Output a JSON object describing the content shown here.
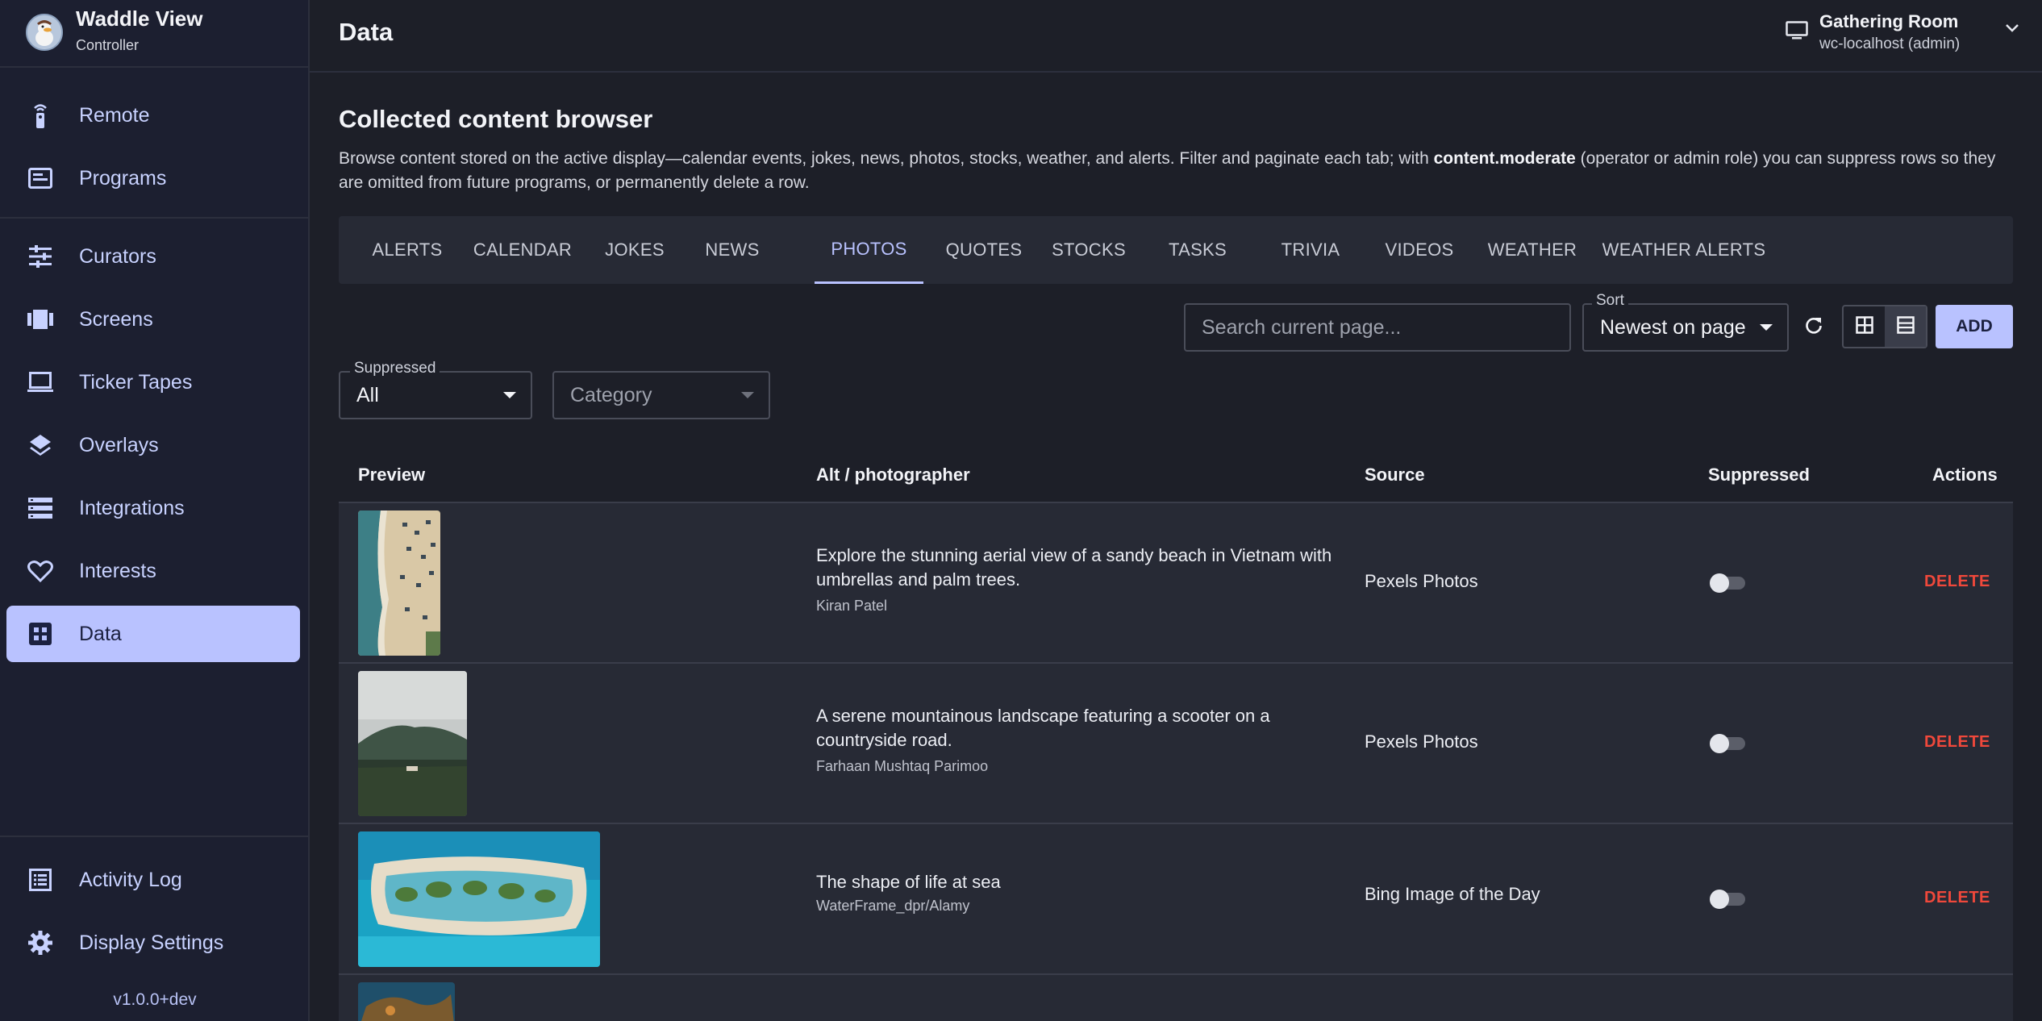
{
  "app": {
    "title": "Waddle View",
    "subtitle": "Controller",
    "version": "v1.0.0+dev"
  },
  "sidebar": {
    "items": [
      {
        "label": "Remote",
        "icon": "remote-icon"
      },
      {
        "label": "Programs",
        "icon": "programs-icon"
      },
      {
        "label": "Curators",
        "icon": "sliders-icon"
      },
      {
        "label": "Screens",
        "icon": "screens-icon"
      },
      {
        "label": "Ticker Tapes",
        "icon": "monitor-icon"
      },
      {
        "label": "Overlays",
        "icon": "layers-icon"
      },
      {
        "label": "Integrations",
        "icon": "list-icon"
      },
      {
        "label": "Interests",
        "icon": "heart-icon"
      },
      {
        "label": "Data",
        "icon": "grid-icon",
        "active": true
      }
    ],
    "footer_items": [
      {
        "label": "Activity Log",
        "icon": "log-icon"
      },
      {
        "label": "Display Settings",
        "icon": "gear-icon"
      }
    ]
  },
  "header": {
    "title": "Data",
    "display": {
      "name": "Gathering Room",
      "host": "wc-localhost (admin)"
    }
  },
  "main": {
    "heading": "Collected content browser",
    "description_pre": "Browse content stored on the active display—calendar events, jokes, news, photos, stocks, weather, and alerts. Filter and paginate each tab; with ",
    "description_bold": "content.moderate",
    "description_post": " (operator or admin role) you can suppress rows so they are omitted from future programs, or permanently delete a row.",
    "tabs": [
      "ALERTS",
      "CALENDAR",
      "JOKES",
      "NEWS",
      "PHOTOS",
      "QUOTES",
      "STOCKS",
      "TASKS",
      "TRIVIA",
      "VIDEOS",
      "WEATHER",
      "WEATHER ALERTS"
    ],
    "active_tab": "PHOTOS",
    "search_placeholder": "Search current page...",
    "sort": {
      "label": "Sort",
      "value": "Newest on page"
    },
    "add_label": "ADD",
    "filters": {
      "suppressed": {
        "label": "Suppressed",
        "value": "All"
      },
      "category": {
        "placeholder": "Category"
      }
    },
    "table": {
      "columns": [
        "Preview",
        "Alt / photographer",
        "Source",
        "Suppressed",
        "Actions"
      ],
      "rows": [
        {
          "alt": "Explore the stunning aerial view of a sandy beach in Vietnam with umbrellas and palm trees.",
          "photographer": "Kiran Patel",
          "source": "Pexels Photos",
          "suppressed": false,
          "action": "DELETE"
        },
        {
          "alt": "A serene mountainous landscape featuring a scooter on a countryside road.",
          "photographer": "Farhaan Mushtaq Parimoo",
          "source": "Pexels Photos",
          "suppressed": false,
          "action": "DELETE"
        },
        {
          "alt": "The shape of life at sea",
          "photographer": "WaterFrame_dpr/Alamy",
          "source": "Bing Image of the Day",
          "suppressed": false,
          "action": "DELETE"
        }
      ]
    }
  },
  "colors": {
    "accent": "#b9c2ff",
    "danger": "#f0483b",
    "background": "#1d1f28",
    "sidebar": "#1c1f30",
    "surface": "#272a35"
  }
}
